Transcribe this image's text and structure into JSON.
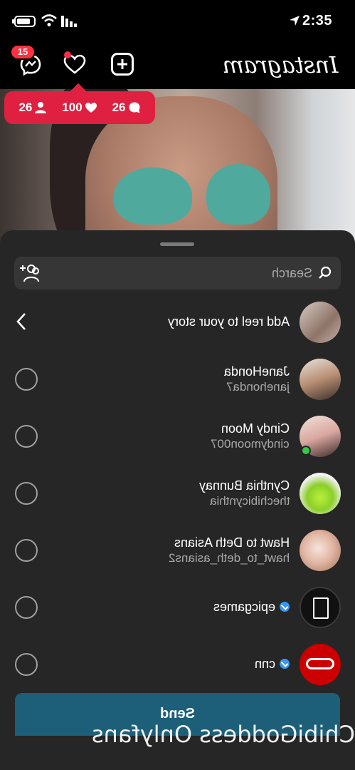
{
  "status_bar": {
    "time": "2:35",
    "icons": [
      "battery-charging-icon",
      "wifi-icon",
      "signal-icon",
      "location-arrow-icon"
    ]
  },
  "header": {
    "logo": "Instagram",
    "messages_badge": "15",
    "icons": [
      "messenger-icon",
      "heart-icon",
      "new-post-icon"
    ]
  },
  "notification": {
    "comments": "26",
    "likes": "100",
    "followers": "26"
  },
  "share_sheet": {
    "search_placeholder": "Search",
    "story_row_label": "Add reel to your story",
    "contacts": [
      {
        "name": "JaneHonda",
        "username": "janehonda7",
        "verified": false
      },
      {
        "name": "Cindy Moon",
        "username": "cindymoon007",
        "verified": false,
        "online": true
      },
      {
        "name": "Cynthia Bunnay",
        "username": "thechibicynthia",
        "verified": false
      },
      {
        "name": "Hawt to Deth Asians",
        "username": "hawt_to_deth_asians2",
        "verified": false
      },
      {
        "name": "epicgames",
        "username": "",
        "verified": true
      },
      {
        "name": "cnn",
        "username": "",
        "verified": true
      }
    ],
    "send_label": "Send"
  },
  "watermark": "ChibiGoddess Onlyfans",
  "colors": {
    "sheet_bg": "#262626",
    "search_bg": "#363636",
    "send_bg": "#1d5e78",
    "notification_bg": "#e02040",
    "verified": "#3897f0",
    "online": "#37c84a"
  }
}
